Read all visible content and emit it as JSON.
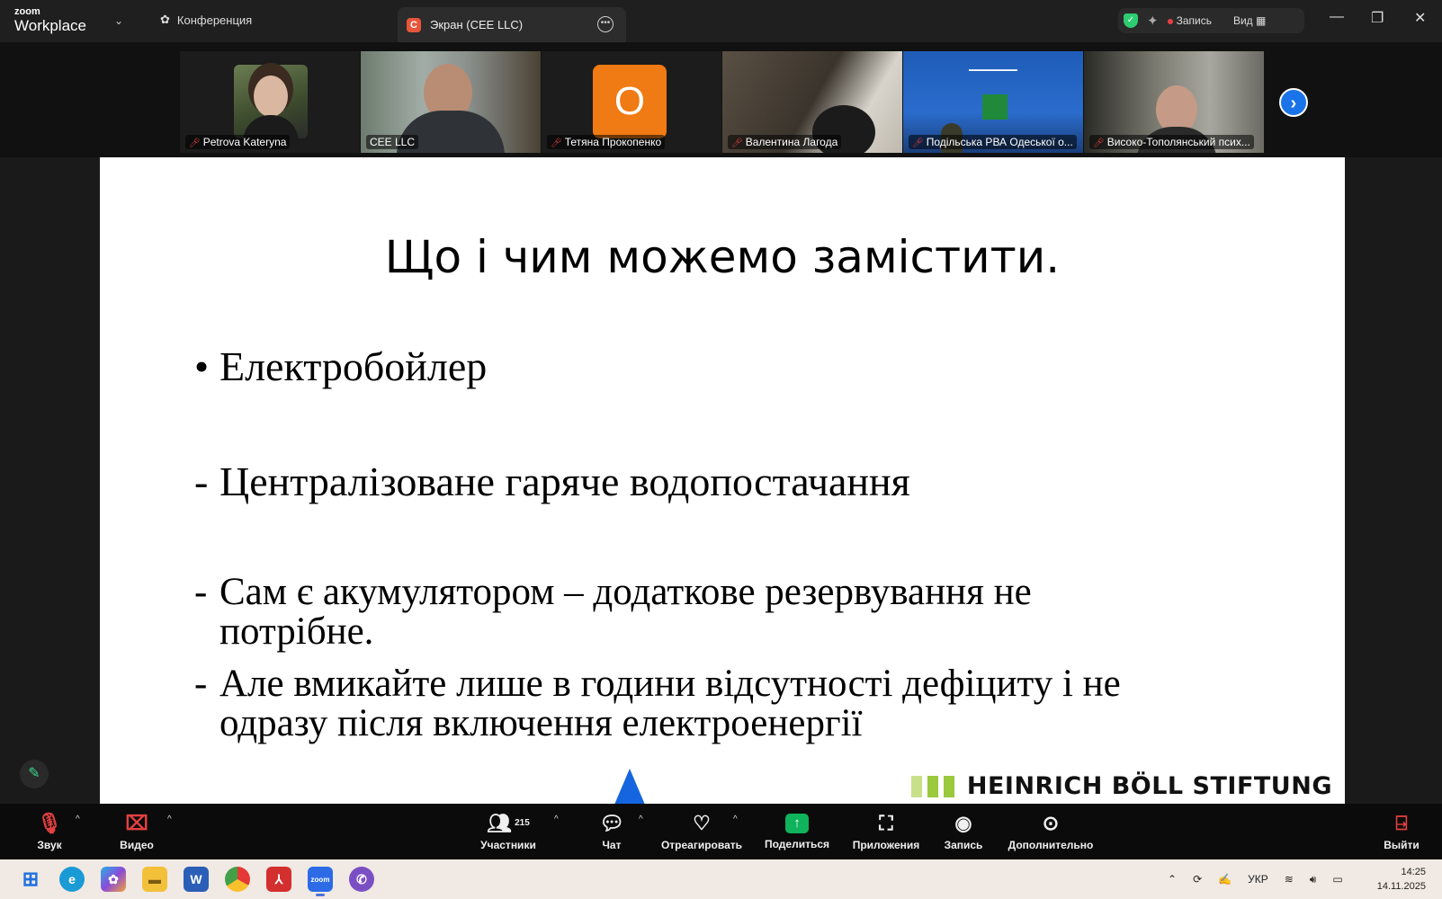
{
  "window": {
    "brand_top": "zoom",
    "brand_bottom": "Workplace",
    "tab_conference": "Конференция",
    "tab_screen_badge": "C",
    "tab_screen": "Экран (CEE LLC)",
    "record_label": "Запись",
    "view_label": "Вид"
  },
  "participants": [
    {
      "name": "Petrova Kateryna",
      "muted": true
    },
    {
      "name": "CEE LLC",
      "muted": false
    },
    {
      "name": "Тетяна Прокопенко",
      "muted": true,
      "initial": "О"
    },
    {
      "name": "Валентина Лагода",
      "muted": true
    },
    {
      "name": "Подільська РВА Одеської о...",
      "muted": true
    },
    {
      "name": "Високо-Тополянський псих...",
      "muted": true
    }
  ],
  "slide": {
    "title": "Що і чим можемо замістити.",
    "items": [
      {
        "marker": "•",
        "text": "Електробойлер"
      },
      {
        "marker": "-",
        "text": "Централізоване гаряче водопостачання"
      },
      {
        "marker": "-",
        "line1": "Сам є акумулятором – додаткове резервування не",
        "line2": "потрібне."
      },
      {
        "marker": "-",
        "line1": "Але вмикайте лише в години відсутності дефіциту і не",
        "line2": "одразу після включення електроенергії"
      }
    ],
    "logo_text": "HEINRICH BÖLL STIFTUNG"
  },
  "toolbar": {
    "audio": "Звук",
    "video": "Видео",
    "participants": "Участники",
    "participants_count": "215",
    "chat": "Чат",
    "react": "Отреагировать",
    "share": "Поделиться",
    "apps": "Приложения",
    "record": "Запись",
    "more": "Дополнительно",
    "leave": "Выйти"
  },
  "taskbar": {
    "lang": "УКР",
    "time": "14:25",
    "date": "14.11.2025"
  }
}
